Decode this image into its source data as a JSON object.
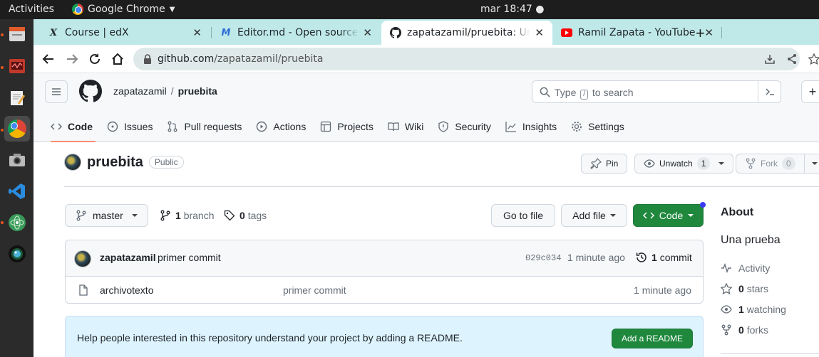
{
  "os_bar": {
    "activities": "Activities",
    "app_name": "Google Chrome",
    "clock": "mar 18:47"
  },
  "tabs": [
    {
      "label": "Course | edX",
      "favicon": "edx-icon"
    },
    {
      "label": "Editor.md - Open source on",
      "favicon": "editormd-icon"
    },
    {
      "label": "zapatazamil/pruebita: Un",
      "favicon": "github-icon"
    },
    {
      "label": "Ramil Zapata - YouTube",
      "favicon": "youtube-icon"
    }
  ],
  "omnibox": {
    "host": "github.com",
    "path": "/zapatazamil/pruebita"
  },
  "header": {
    "owner": "zapatazamil",
    "slash": "/",
    "repo": "pruebita",
    "search_prefix": "Type",
    "search_key": "/",
    "search_suffix": "to search"
  },
  "repo_nav": [
    {
      "label": "Code",
      "icon": "code-icon"
    },
    {
      "label": "Issues",
      "icon": "issue-icon"
    },
    {
      "label": "Pull requests",
      "icon": "pull-request-icon"
    },
    {
      "label": "Actions",
      "icon": "play-icon"
    },
    {
      "label": "Projects",
      "icon": "table-icon"
    },
    {
      "label": "Wiki",
      "icon": "book-icon"
    },
    {
      "label": "Security",
      "icon": "shield-icon"
    },
    {
      "label": "Insights",
      "icon": "graph-icon"
    },
    {
      "label": "Settings",
      "icon": "gear-icon"
    }
  ],
  "repo": {
    "name": "pruebita",
    "visibility": "Public",
    "pin_label": "Pin",
    "watch_label": "Unwatch",
    "watch_count": "1",
    "fork_label": "Fork",
    "fork_count": "0"
  },
  "branch_bar": {
    "branch": "master",
    "branch_count": "1",
    "branch_word": "branch",
    "tag_count": "0",
    "tag_word": "tags",
    "goto_file": "Go to file",
    "add_file": "Add file",
    "code": "Code"
  },
  "latest_commit": {
    "author": "zapatazamil",
    "message": "primer commit",
    "sha": "029c034",
    "age": "1 minute ago",
    "count": "1",
    "count_word": "commit"
  },
  "files": [
    {
      "name": "archivotexto",
      "message": "primer commit",
      "age": "1 minute ago"
    }
  ],
  "readme_prompt": {
    "text": "Help people interested in this repository understand your project by adding a README.",
    "button": "Add a README"
  },
  "about": {
    "heading": "About",
    "description": "Una prueba",
    "activity": "Activity",
    "stars_count": "0",
    "stars_word": "stars",
    "watching_count": "1",
    "watching_word": "watching",
    "forks_count": "0",
    "forks_word": "forks"
  },
  "colors": {
    "tab_strip": "#bfe9e9",
    "primary_green": "#1f883d",
    "nav_underline": "#fd8c73"
  }
}
